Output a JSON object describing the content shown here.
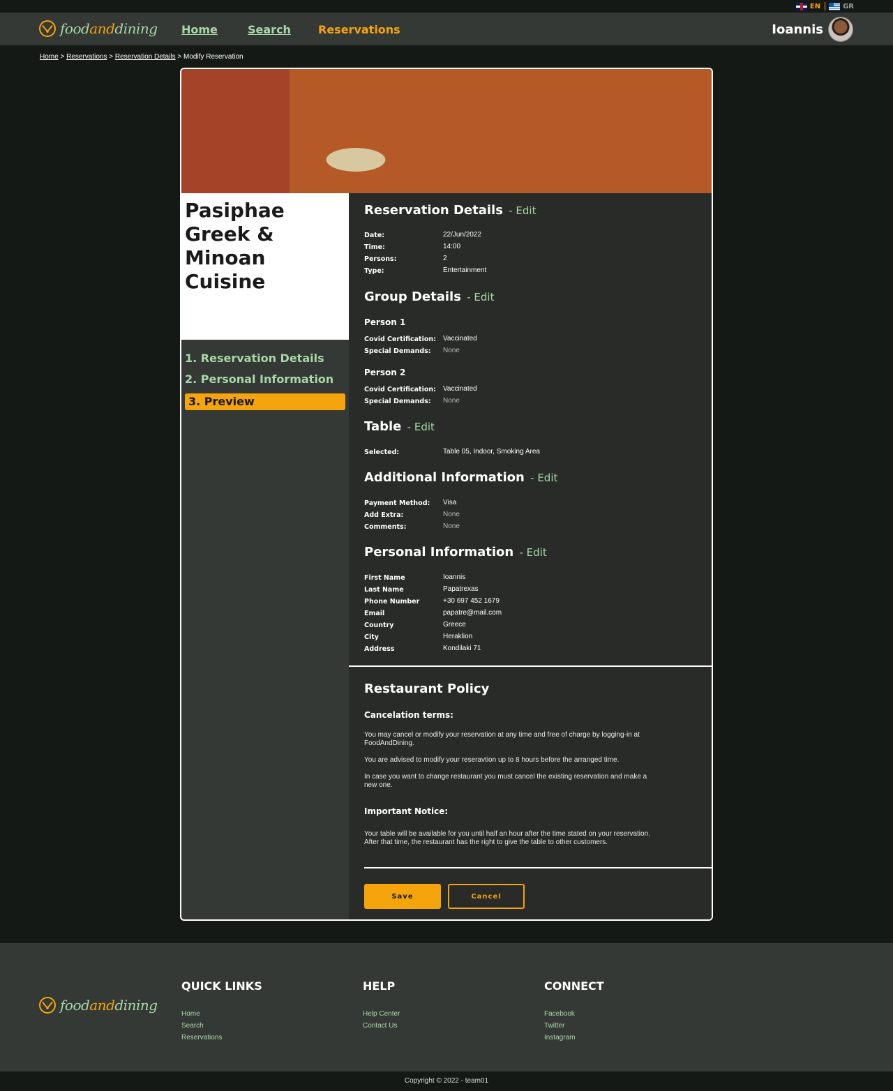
{
  "lang": {
    "en": "EN",
    "gr": "GR"
  },
  "brand": {
    "part1": "food",
    "part2": "and",
    "part3": "dining"
  },
  "nav": {
    "home": "Home",
    "search": "Search",
    "reservations": "Reservations",
    "user": "Ioannis"
  },
  "breadcrumb": {
    "home": "Home",
    "reservations": "Reservations",
    "details": "Reservation Details",
    "current": "Modify Reservation",
    "sep": ">"
  },
  "restaurant": {
    "name": "Pasiphae Greek & Minoan Cuisine"
  },
  "steps": [
    "1. Reservation Details",
    "2. Personal Information",
    "3. Preview"
  ],
  "edit_label": "- Edit",
  "reservation": {
    "title": "Reservation Details",
    "rows": [
      {
        "k": "Date:",
        "v": "22/Jun/2022"
      },
      {
        "k": "Time:",
        "v": "14:00"
      },
      {
        "k": "Persons:",
        "v": "2"
      },
      {
        "k": "Type:",
        "v": "Entertainment"
      }
    ]
  },
  "group": {
    "title": "Group Details",
    "persons": [
      {
        "title": "Person 1",
        "rows": [
          {
            "k": "Covid Certification:",
            "v": "Vaccinated"
          },
          {
            "k": "Special Demands:",
            "v": "None"
          }
        ]
      },
      {
        "title": "Person 2",
        "rows": [
          {
            "k": "Covid Certification:",
            "v": "Vaccinated"
          },
          {
            "k": "Special Demands:",
            "v": "None"
          }
        ]
      }
    ]
  },
  "table": {
    "title": "Table",
    "rows": [
      {
        "k": "Selected:",
        "v": "Table 05, Indoor, Smoking Area"
      }
    ]
  },
  "additional": {
    "title": "Additional Information",
    "rows": [
      {
        "k": "Payment Method:",
        "v": "Visa"
      },
      {
        "k": "Add Extra:",
        "v": "None"
      },
      {
        "k": "Comments:",
        "v": "None"
      }
    ]
  },
  "personal": {
    "title": "Personal Information",
    "rows": [
      {
        "k": "First Name",
        "v": "Ioannis"
      },
      {
        "k": "Last Name",
        "v": "Papatrexas"
      },
      {
        "k": "Phone Number",
        "v": "+30 697 452 1679"
      },
      {
        "k": "Email",
        "v": "papatre@mail.com"
      },
      {
        "k": "Country",
        "v": "Greece"
      },
      {
        "k": "City",
        "v": "Heraklion"
      },
      {
        "k": "Address",
        "v": "Kondilaki 71"
      }
    ]
  },
  "policy": {
    "title": "Restaurant Policy",
    "cancel_title": "Cancelation terms:",
    "p1": "You may cancel or modify your reservation at any time and free of charge by logging-in at FoodAndDining.",
    "p2": "You are advised to modify your reseravtion up to 8 hours before the arranged time.",
    "p3": "In case you want to change restaurant you must cancel the existing reservation and make a new one.",
    "notice_title": "Important Notice:",
    "p4": "Your table will be available for you until half an hour after the time stated on your reservation. After that time, the restaurant has the right to give the table to other customers."
  },
  "buttons": {
    "save": "Save",
    "cancel": "Cancel"
  },
  "footer": {
    "quick_title": "QUICK LINKS",
    "quick": [
      "Home",
      "Search",
      "Reservations"
    ],
    "help_title": "HELP",
    "help": [
      "Help Center",
      "Contact Us"
    ],
    "connect_title": "CONNECT",
    "connect": [
      "Facebook",
      "Twitter",
      "Instagram"
    ],
    "copyright": "Copyright © 2022 - team01"
  },
  "colors": {
    "accent": "#f5a40c",
    "green": "#a8d8a8",
    "bg": "#141915",
    "panel": "#353936",
    "dark": "#282b28"
  }
}
